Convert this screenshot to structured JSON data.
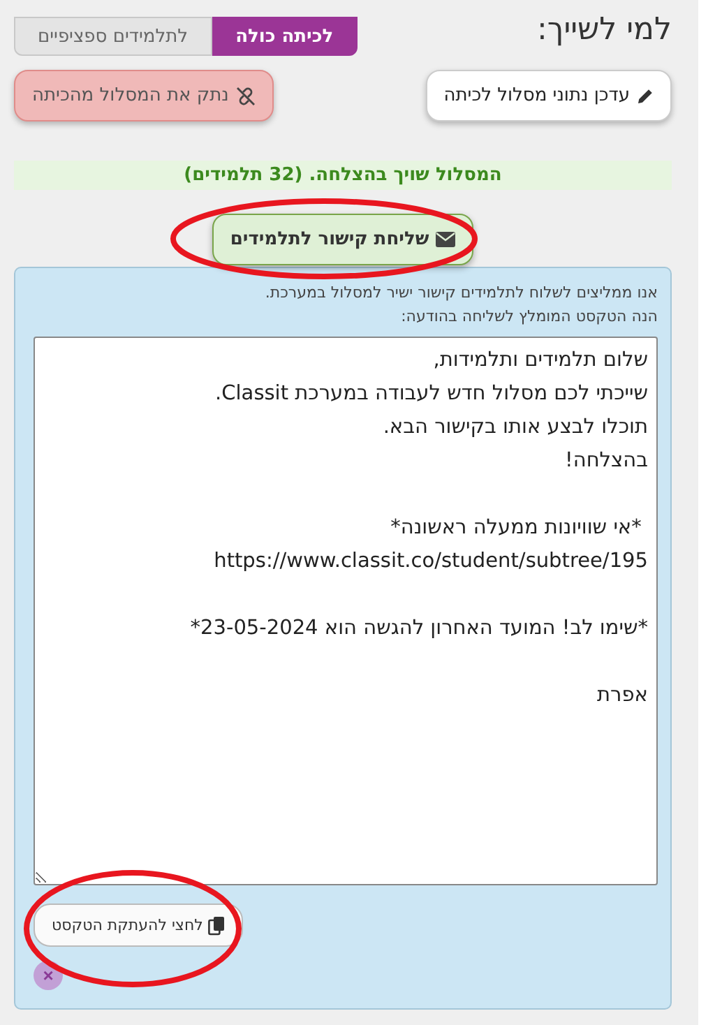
{
  "heading": "למי לשייך:",
  "tabs": [
    {
      "label": "לכיתה כולה",
      "selected": true
    },
    {
      "label": "לתלמידים ספציפיים",
      "selected": false
    }
  ],
  "actions": [
    {
      "label": "עדכן נתוני מסלול לכיתה",
      "kind": "edit"
    },
    {
      "label": "נתק את המסלול מהכיתה",
      "kind": "unlink"
    }
  ],
  "success_message": "המסלול שויך בהצלחה. (32 תלמידים)",
  "send_button": "שליחת קישור לתלמידים",
  "panel": {
    "intro": [
      "אנו ממליצים לשלוח לתלמידים קישור ישיר למסלול במערכת.",
      "הנה הטקסט המומלץ לשליחה בהודעה:"
    ],
    "message": "שלום תלמידים ותלמידות,\nשייכתי לכם מסלול חדש לעבודה במערכת Classit.\nתוכלו לבצע אותו בקישור הבא.\nבהצלחה!\n\n *אי שוויונות ממעלה ראשונה*\nhttps://www.classit.co/student/subtree/195\n\n*שימו לב! המועד האחרון להגשה הוא 23-05-2024*\n\nאפרת",
    "copy_button": "לחצי להעתקת הטקסט",
    "close_button": "×"
  }
}
